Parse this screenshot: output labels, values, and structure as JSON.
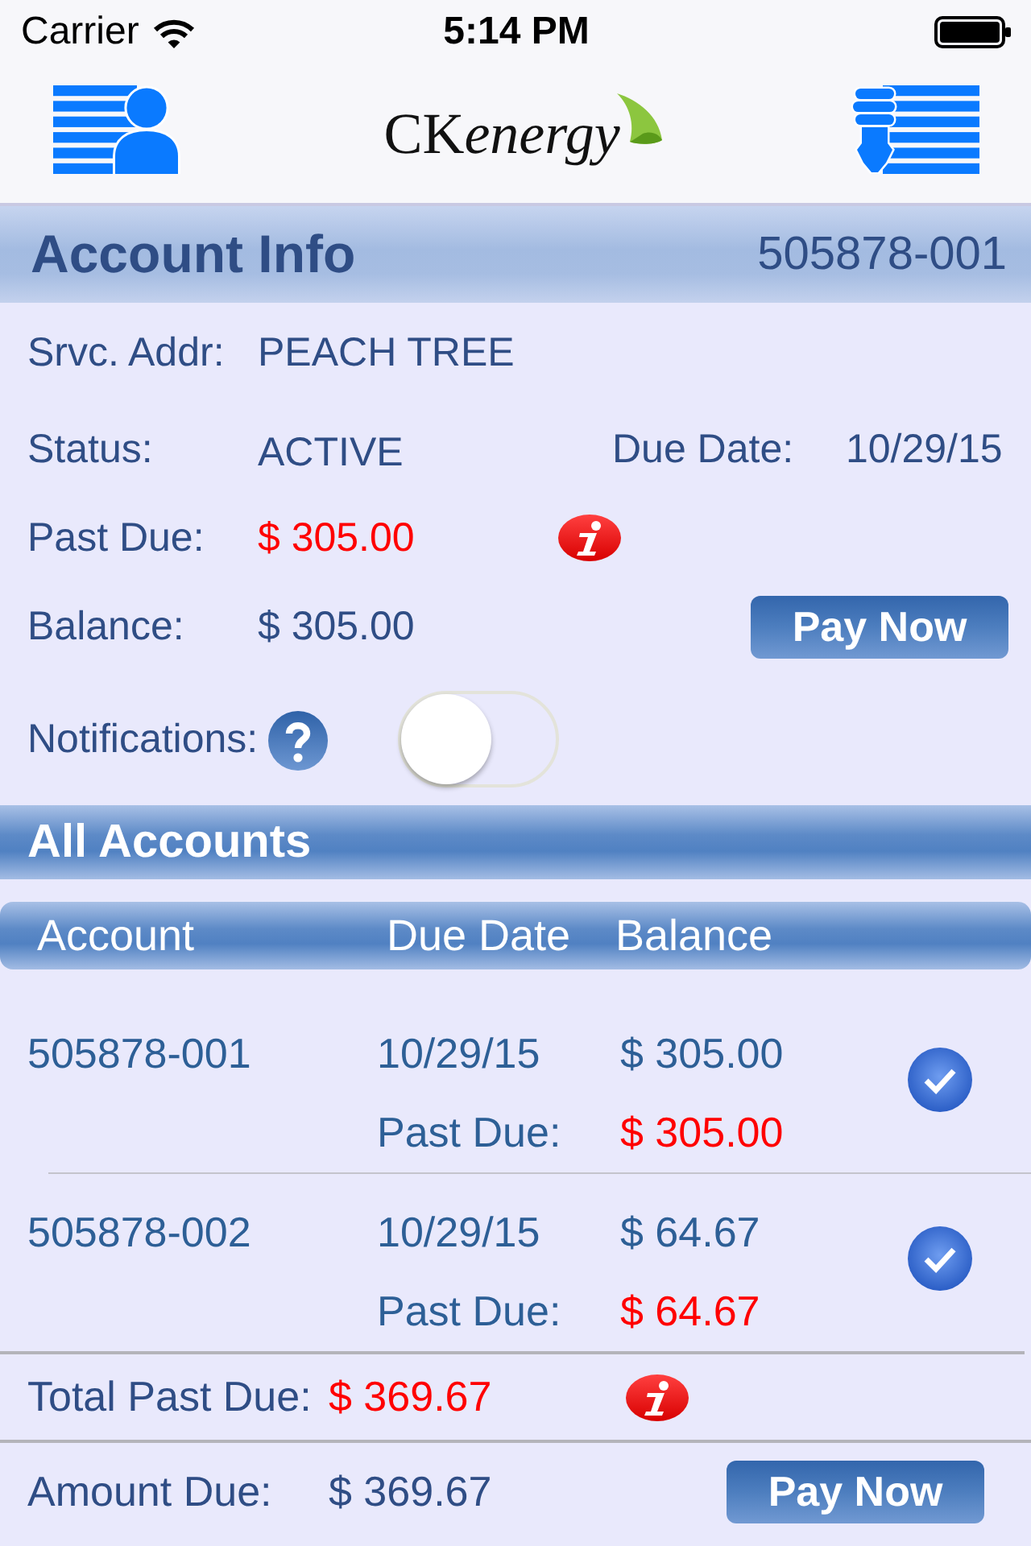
{
  "status_bar": {
    "carrier": "Carrier",
    "time": "5:14 PM"
  },
  "nav_bar": {
    "logo": {
      "upright": "CK",
      "italic": "energy"
    }
  },
  "account_info": {
    "title": "Account Info",
    "account_number": "505878-001",
    "service_address": {
      "label": "Srvc. Addr:",
      "value": "PEACH TREE"
    },
    "status": {
      "label": "Status:",
      "value": "ACTIVE"
    },
    "due_date": {
      "label": "Due Date:",
      "value": "10/29/15"
    },
    "past_due": {
      "label": "Past Due:",
      "value": "$ 305.00"
    },
    "balance": {
      "label": "Balance:",
      "value": "$ 305.00"
    },
    "pay_button": "Pay Now",
    "notifications": {
      "label": "Notifications:",
      "on": false
    }
  },
  "all_accounts": {
    "title": "All Accounts",
    "columns": [
      "Account",
      "Due Date",
      "Balance"
    ],
    "rows": [
      {
        "account": "505878-001",
        "due_date": "10/29/15",
        "balance": "$ 305.00",
        "past_due_label": "Past Due:",
        "past_due": "$ 305.00",
        "selected": true
      },
      {
        "account": "505878-002",
        "due_date": "10/29/15",
        "balance": "$ 64.67",
        "past_due_label": "Past Due:",
        "past_due": "$ 64.67",
        "selected": true
      }
    ],
    "total_past_due": {
      "label": "Total Past Due:",
      "value": "$ 369.67"
    },
    "amount_due": {
      "label": "Amount Due:",
      "value": "$ 369.67"
    },
    "pay_button": "Pay Now"
  }
}
